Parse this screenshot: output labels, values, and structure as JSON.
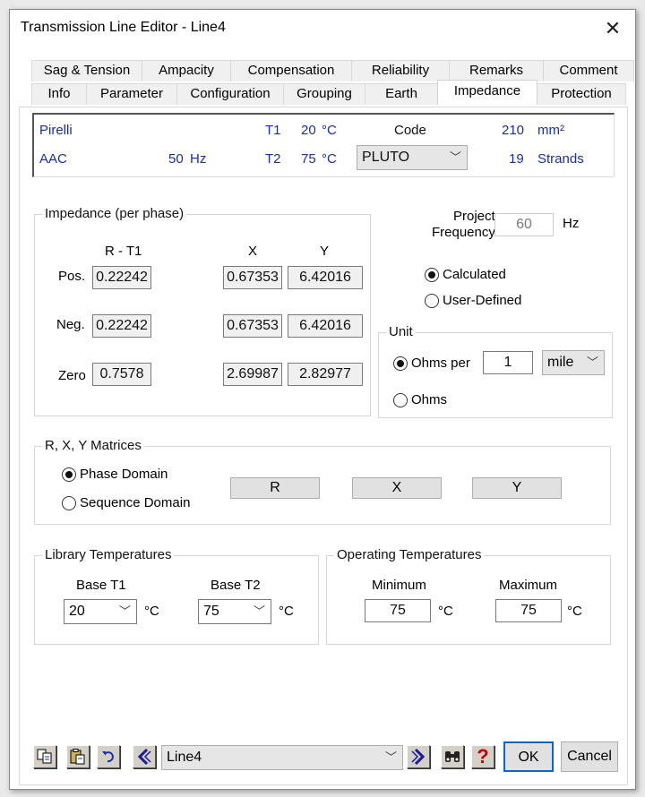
{
  "window": {
    "title": "Transmission Line Editor - Line4",
    "close_icon": "close-icon"
  },
  "tabs": {
    "row_top": [
      {
        "label": "Sag & Tension"
      },
      {
        "label": "Ampacity"
      },
      {
        "label": "Compensation"
      },
      {
        "label": "Reliability"
      },
      {
        "label": "Remarks"
      },
      {
        "label": "Comment"
      }
    ],
    "row_bottom": [
      {
        "label": "Info"
      },
      {
        "label": "Parameter"
      },
      {
        "label": "Configuration"
      },
      {
        "label": "Grouping"
      },
      {
        "label": "Earth"
      },
      {
        "label": "Impedance"
      },
      {
        "label": "Protection"
      }
    ],
    "active": "Impedance"
  },
  "info": {
    "manufacturer": "Pirelli",
    "type": "AAC",
    "frequency": "50",
    "frequency_unit": "Hz",
    "t1_label": "T1",
    "t1_value": "20",
    "t1_unit": "°C",
    "t2_label": "T2",
    "t2_value": "75",
    "t2_unit": "°C",
    "code_label": "Code",
    "code_value": "PLUTO",
    "size": "210",
    "size_unit": "mm²",
    "strands": "19",
    "strands_label": "Strands"
  },
  "impedance": {
    "title": "Impedance (per phase)",
    "col_r": "R - T1",
    "col_x": "X",
    "col_y": "Y",
    "rows": [
      {
        "label": "Pos.",
        "r": "0.22242",
        "x": "0.67353",
        "y": "6.42016"
      },
      {
        "label": "Neg.",
        "r": "0.22242",
        "x": "0.67353",
        "y": "6.42016"
      },
      {
        "label": "Zero",
        "r": "0.7578",
        "x": "2.69987",
        "y": "2.82977"
      }
    ]
  },
  "project_frequency": {
    "label_line1": "Project",
    "label_line2": "Frequency",
    "value": "60",
    "unit": "Hz"
  },
  "mode": {
    "calculated": "Calculated",
    "user_defined": "User-Defined",
    "selected": "Calculated"
  },
  "unit": {
    "title": "Unit",
    "ohms_per": "Ohms per",
    "ohms_per_value": "1",
    "length_unit": "mile",
    "ohms": "Ohms",
    "selected": "Ohms per"
  },
  "matrices": {
    "title": "R, X, Y Matrices",
    "phase_domain": "Phase Domain",
    "sequence_domain": "Sequence Domain",
    "selected": "Phase Domain",
    "btn_r": "R",
    "btn_x": "X",
    "btn_y": "Y"
  },
  "library_temps": {
    "title": "Library Temperatures",
    "base_t1_label": "Base T1",
    "base_t1_value": "20",
    "base_t2_label": "Base T2",
    "base_t2_value": "75",
    "unit": "°C"
  },
  "operating_temps": {
    "title": "Operating Temperatures",
    "min_label": "Minimum",
    "min_value": "75",
    "max_label": "Maximum",
    "max_value": "75",
    "unit": "°C"
  },
  "footer": {
    "record_value": "Line4",
    "ok": "OK",
    "cancel": "Cancel"
  },
  "colors": {
    "info_text": "#1a2fa0",
    "nav_arrow": "#1a1a9a",
    "help_red": "#cc0000",
    "ok_border": "#0a64d6"
  }
}
